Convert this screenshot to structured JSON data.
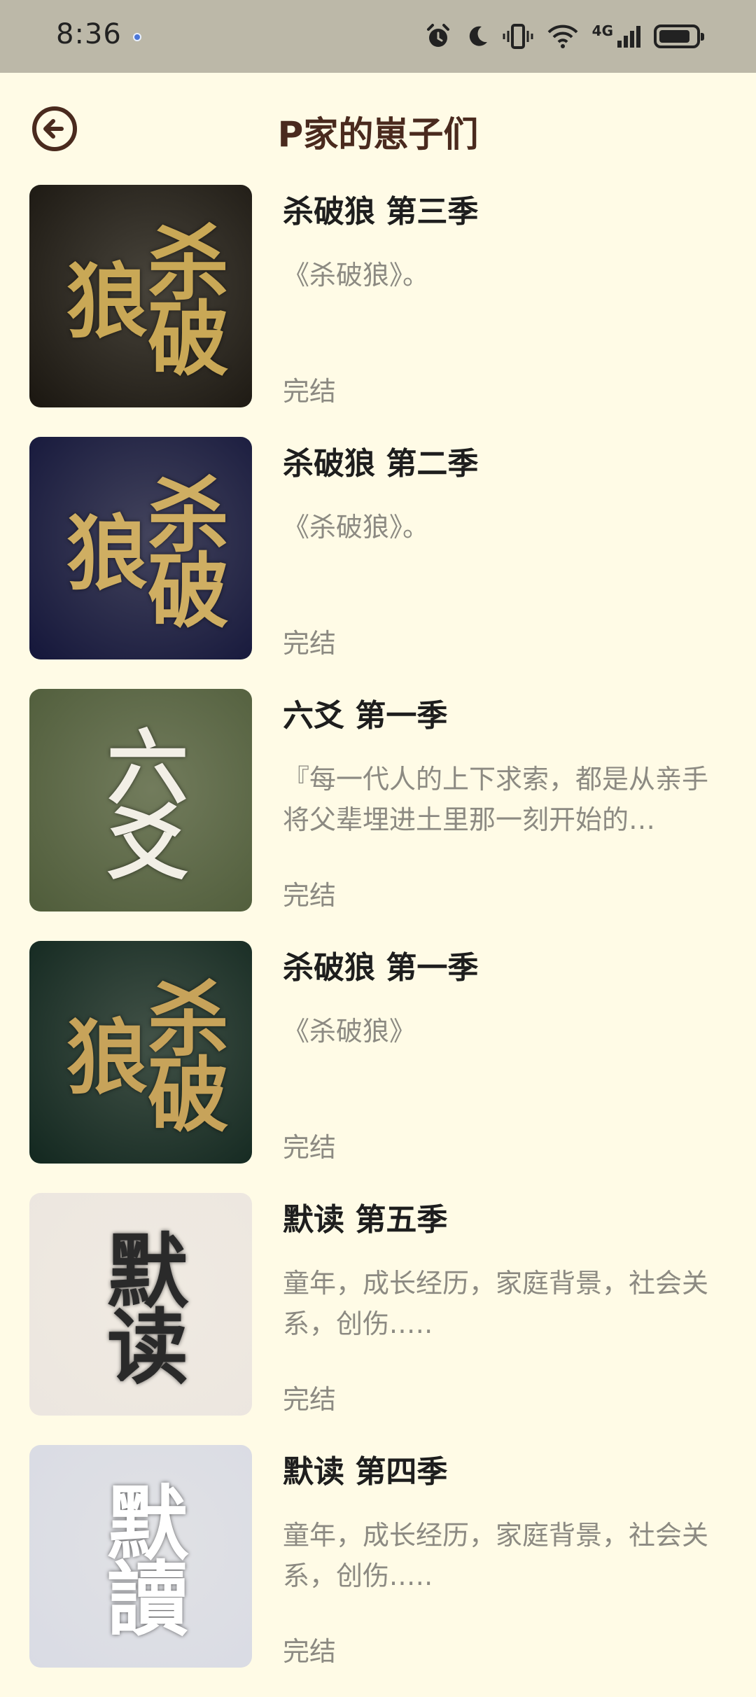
{
  "status_bar": {
    "time": "8:36",
    "network": "4G",
    "battery_level": 0.85
  },
  "header": {
    "title": "P家的崽子们",
    "back_icon": "arrow-left-circle-icon"
  },
  "colors": {
    "background": "#fffbe6",
    "status_bar": "#bcb8a8",
    "title": "#4a2a1e",
    "secondary_text": "#8c8a82"
  },
  "items": [
    {
      "title": "杀破狼 第三季",
      "description": "《杀破狼》。",
      "status": "完结",
      "cover_text": "杀破狼",
      "cover_bg": "#1a1610",
      "cover_fg": "#c9a856"
    },
    {
      "title": "杀破狼 第二季",
      "description": "《杀破狼》。",
      "status": "完结",
      "cover_text": "杀破狼",
      "cover_bg": "#14163a",
      "cover_fg": "#cfae62"
    },
    {
      "title": "六爻 第一季",
      "description": "『每一代人的上下求索，都是从亲手将父辈埋进土里那一刻开始的…",
      "status": "完结",
      "cover_text": "六爻",
      "cover_bg": "#4f5c3a",
      "cover_fg": "#f2efe6"
    },
    {
      "title": "杀破狼 第一季",
      "description": "《杀破狼》",
      "status": "完结",
      "cover_text": "杀破狼",
      "cover_bg": "#12271f",
      "cover_fg": "#c7a35a"
    },
    {
      "title": "默读 第五季",
      "description": "童年，成长经历，家庭背景，社会关系，创伤.….",
      "status": "完结",
      "cover_text": "默读",
      "cover_bg": "#ece6e0",
      "cover_fg": "#2a2a2a"
    },
    {
      "title": "默读 第四季",
      "description": "童年，成长经历，家庭背景，社会关系，创伤.….",
      "status": "完结",
      "cover_text": "默讀",
      "cover_bg": "#d9dbe4",
      "cover_fg": "#ffffff"
    }
  ]
}
